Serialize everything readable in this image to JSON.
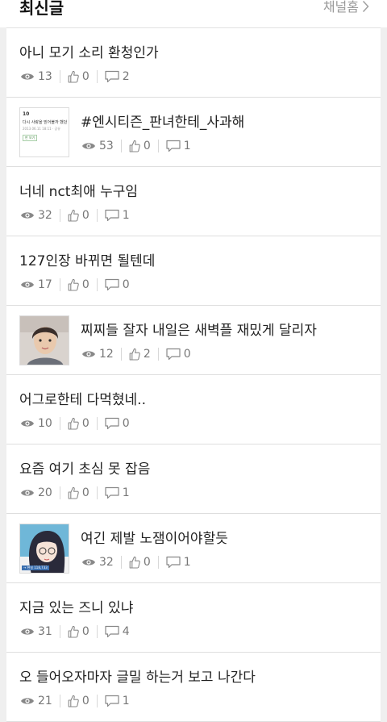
{
  "header": {
    "title": "최신글",
    "channel_link": "채널홈"
  },
  "posts": [
    {
      "title": "아니 모기 소리 환청인가",
      "views": "13",
      "likes": "0",
      "comments": "2",
      "thumb": null
    },
    {
      "title": "#엔시티즌_판녀한테_사과해",
      "views": "53",
      "likes": "0",
      "comments": "1",
      "thumb": "document"
    },
    {
      "title": "너네 nct최애 누구임",
      "views": "32",
      "likes": "0",
      "comments": "1",
      "thumb": null
    },
    {
      "title": "127인장 바뀌면 될텐데",
      "views": "17",
      "likes": "0",
      "comments": "0",
      "thumb": null
    },
    {
      "title": "찌찌들 잘자 내일은 새벽플 재밌게 달리자",
      "views": "12",
      "likes": "2",
      "comments": "0",
      "thumb": "portrait"
    },
    {
      "title": "어그로한테 다먹혔네..",
      "views": "10",
      "likes": "0",
      "comments": "0",
      "thumb": null
    },
    {
      "title": "요즘 여기 초심 못 잡음",
      "views": "20",
      "likes": "0",
      "comments": "1",
      "thumb": null
    },
    {
      "title": "여긴 제발 노잼이어야할듯",
      "views": "32",
      "likes": "0",
      "comments": "1",
      "thumb": "illustration"
    },
    {
      "title": "지금 있는 즈니 있냐",
      "views": "31",
      "likes": "0",
      "comments": "4",
      "thumb": null
    },
    {
      "title": "오 들어오자마자 글밀 하는거 보고 나간다",
      "views": "21",
      "likes": "0",
      "comments": "1",
      "thumb": null
    }
  ],
  "thumb_document_text": {
    "line1": "10",
    "line2": "다시 사랑을 믿어볼까 했던",
    "line3": "2013.06.11 18:11 · 공유",
    "tag": "판 보기"
  },
  "thumb_illustration_caption": "→ 현실 118,733"
}
